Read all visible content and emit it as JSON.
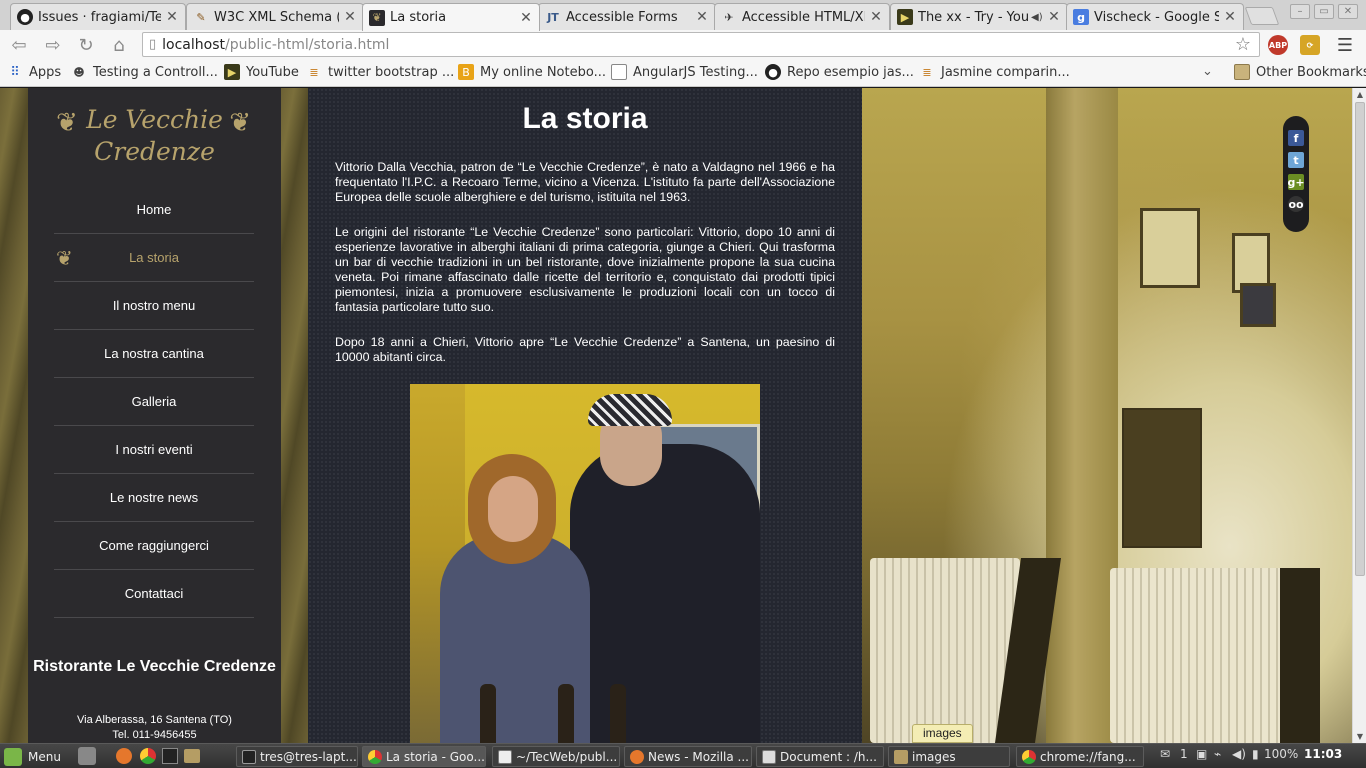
{
  "browser": {
    "tabs": [
      {
        "title": "Issues · fragiami/Tec",
        "icon": "github-icon",
        "active": false
      },
      {
        "title": "W3C XML Schema (",
        "icon": "w3c-icon",
        "active": false
      },
      {
        "title": "La storia",
        "icon": "page-favicon-icon",
        "active": true
      },
      {
        "title": "Accessible Forms",
        "icon": "wp-icon",
        "active": false
      },
      {
        "title": "Accessible HTML/XH",
        "icon": "bird-icon",
        "active": false
      },
      {
        "title": "The xx - Try - YouT",
        "icon": "youtube-icon",
        "active": false
      },
      {
        "title": "Vischeck - Google Se",
        "icon": "google-icon",
        "active": false
      }
    ],
    "url_host": "localhost",
    "url_path": "/public-html/storia.html",
    "extensions": [
      "ABP"
    ],
    "bookmarks": [
      {
        "label": "Apps",
        "icon": "apps-grid-icon"
      },
      {
        "label": "Testing a Controll...",
        "icon": "dog-icon"
      },
      {
        "label": "YouTube",
        "icon": "youtube-icon"
      },
      {
        "label": "twitter bootstrap ...",
        "icon": "stack-icon"
      },
      {
        "label": "My online Notebo...",
        "icon": "blogger-icon"
      },
      {
        "label": "AngularJS Testing...",
        "icon": "page-icon"
      },
      {
        "label": "Repo esempio jas...",
        "icon": "github-icon"
      },
      {
        "label": "Jasmine comparin...",
        "icon": "stack-icon"
      }
    ],
    "other_bookmarks": "Other Bookmarks"
  },
  "site": {
    "logo_line1": "Le Vecchie",
    "logo_line2": "Credenze",
    "nav": [
      {
        "label": "Home",
        "active": false
      },
      {
        "label": "La storia",
        "active": true
      },
      {
        "label": "Il nostro menu",
        "active": false
      },
      {
        "label": "La nostra cantina",
        "active": false
      },
      {
        "label": "Galleria",
        "active": false
      },
      {
        "label": "I nostri eventi",
        "active": false
      },
      {
        "label": "Le nostre news",
        "active": false
      },
      {
        "label": "Come raggiungerci",
        "active": false
      },
      {
        "label": "Contattaci",
        "active": false
      }
    ],
    "info_title": "Ristorante Le Vecchie Credenze",
    "address": "Via Alberassa, 16 Santena (TO)",
    "phone": "Tel. 011-9456455"
  },
  "content": {
    "title": "La storia",
    "paragraphs": [
      "Vittorio Dalla Vecchia, patron de “Le Vecchie Credenze”, è nato a Valdagno nel 1966 e ha frequentato l'I.P.C. a Recoaro Terme, vicino a Vicenza. L'istituto fa parte dell'Associazione Europea delle scuole alberghiere e del turismo, istituita nel 1963.",
      "Le origini del ristorante “Le Vecchie Credenze” sono particolari: Vittorio, dopo 10 anni di esperienze lavorative in alberghi italiani di prima categoria, giunge a Chieri. Qui trasforma un bar di vecchie tradizioni in un bel ristorante, dove inizialmente propone la sua cucina veneta. Poi rimane affascinato dalle ricette del territorio e, conquistato dai prodotti tipici piemontesi, inizia a promuovere esclusivamente le produzioni locali con un tocco di fantasia particolare tutto suo.",
      "Dopo 18 anni a Chieri, Vittorio apre “Le Vecchie Credenze” a Santena, un paesino di 10000 abitanti circa."
    ]
  },
  "social": [
    "facebook-icon",
    "twitter-icon",
    "google-plus-icon",
    "tripadvisor-icon"
  ],
  "download_tooltip": "images",
  "taskbar": {
    "menu_label": "Menu",
    "tasks": [
      {
        "label": "tres@tres-lapt...",
        "icon": "terminal-icon",
        "active": false
      },
      {
        "label": "La storia - Goo...",
        "icon": "chrome-icon",
        "active": true
      },
      {
        "label": "~/TecWeb/publ...",
        "icon": "editor-icon",
        "active": false
      },
      {
        "label": "News - Mozilla ...",
        "icon": "firefox-icon",
        "active": false
      },
      {
        "label": "Document : /h...",
        "icon": "document-icon",
        "active": false
      },
      {
        "label": "images",
        "icon": "folder-icon",
        "active": false
      },
      {
        "label": "chrome://fang...",
        "icon": "chrome-icon",
        "active": false
      }
    ],
    "notifications": "1",
    "battery": "100%",
    "clock": "11:03"
  }
}
